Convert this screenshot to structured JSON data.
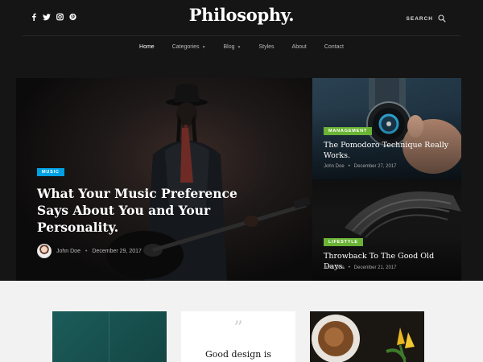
{
  "site": {
    "logo": "Philosophy."
  },
  "social_icons": [
    "facebook-icon",
    "twitter-icon",
    "instagram-icon",
    "pinterest-icon"
  ],
  "search": {
    "label": "SEARCH"
  },
  "nav": [
    {
      "label": "Home",
      "active": true
    },
    {
      "label": "Categories",
      "dropdown": true
    },
    {
      "label": "Blog",
      "dropdown": true
    },
    {
      "label": "Styles"
    },
    {
      "label": "About"
    },
    {
      "label": "Contact"
    }
  ],
  "hero": {
    "category": "MUSIC",
    "title": "What Your Music Preference Says About You and Your Personality.",
    "author": "John Doe",
    "date": "December 29, 2017"
  },
  "side_posts": [
    {
      "category": "MANAGEMENT",
      "title": "The Pomodoro Technique Really Works.",
      "author": "John Doe",
      "date": "December 27, 2017"
    },
    {
      "category": "LIFESTYLE",
      "title": "Throwback To The Good Old Days.",
      "author": "John Doe",
      "date": "December 21, 2017"
    }
  ],
  "lower": {
    "quote_mark": "”",
    "quote_text": "Good design is"
  },
  "colors": {
    "music_badge": "#00a1e4",
    "green_badge": "#6ab335",
    "background": "#151515",
    "lower_bg": "#f2f2f2"
  }
}
